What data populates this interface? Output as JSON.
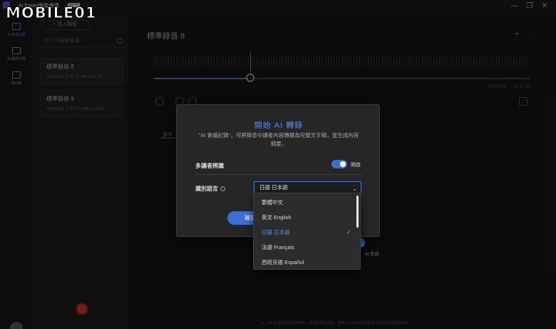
{
  "titlebar": {
    "app_title": "AI Expert智能會議",
    "beta": "BETA",
    "watermark": "MOBILE01",
    "minimize": "—",
    "restore": "❐",
    "close": "✕"
  },
  "rail": {
    "items": [
      {
        "label": "AI 會議記錄",
        "icon": "meeting-record-icon"
      },
      {
        "label": "AI 翻譯字幕",
        "icon": "translate-subtitle-icon"
      },
      {
        "label": "演示稿",
        "icon": "presentation-icon"
      }
    ]
  },
  "list": {
    "import_label": "+ 導入檔案",
    "search_placeholder": "在下方選單搜尋...",
    "recordings": [
      {
        "name": "標準錄音 8",
        "meta": "2026/05/31 17:46  32.7MB  00:17:34"
      },
      {
        "name": "標準錄音 9",
        "meta": "2026/05/31 17:46  127.4MB  01:08:52"
      }
    ]
  },
  "main": {
    "title": "標準錄音 8",
    "time_current": "00:04:24",
    "time_total": "00:17:34",
    "progress": 0.257,
    "tab_label": "逐字",
    "footer": "以上 AI 生成的內容僅供參考，請核對原始內容，使用 AI Expert智能會議 即表示同意服務條款",
    "ai_generate_label": "AI 生成"
  },
  "modal": {
    "title": "開始 AI 轉錄",
    "description": "\"AI 會議記錄\"，可將錄音中講者內容轉錄為完整文字稿，並生成內容摘要。",
    "speaker_label": "多講者辨識",
    "speaker_toggle_label": "開啟",
    "speaker_on": true,
    "language_label": "識別語言",
    "language_value": "日語 日本語",
    "confirm_label": "確定",
    "accent_color": "#3b6fd1"
  },
  "dropdown": {
    "options": [
      {
        "label": "繁體中文",
        "selected": false
      },
      {
        "label": "英文 English",
        "selected": false
      },
      {
        "label": "日語 日本語",
        "selected": true
      },
      {
        "label": "法語 Français",
        "selected": false
      },
      {
        "label": "西班牙語 Español",
        "selected": false
      }
    ]
  }
}
